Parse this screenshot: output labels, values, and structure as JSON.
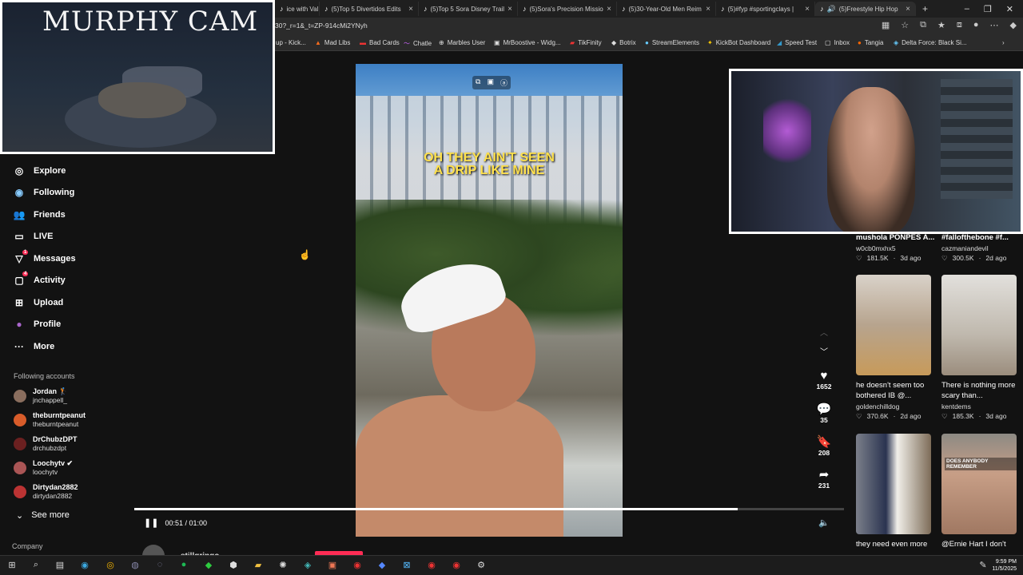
{
  "browser": {
    "tabs": [
      {
        "label": "ice with Val",
        "icon": "♪"
      },
      {
        "label": "(5)Top 5 Divertidos Edits",
        "icon": "♪"
      },
      {
        "label": "(5)Top 5 Sora Disney Trail",
        "icon": "♪"
      },
      {
        "label": "(5)Sora's Precision Missio",
        "icon": "♪"
      },
      {
        "label": "(5)30-Year-Old Men Reim",
        "icon": "♪"
      },
      {
        "label": "(5)#fyp #sportingclays |",
        "icon": "♪"
      },
      {
        "label": "(5)Freestyle Hip Hop",
        "icon": "♪"
      }
    ],
    "new_tab": "+",
    "url": "30?_r=1&_t=ZP-914cMi2YNyh",
    "bookmarks": [
      "up - Kick...",
      "Mad Libs",
      "Bad Cards",
      "Chatle",
      "Marbles User",
      "MrBoostive - Widg...",
      "TikFinity",
      "Botrix",
      "StreamElements",
      "KickBot Dashboard",
      "Speed Test",
      "Inbox",
      "Tangia",
      "Delta Force: Black Si..."
    ]
  },
  "murphy_cam": {
    "title": "MURPHY CAM"
  },
  "sidebar": {
    "items": [
      {
        "label": "Explore",
        "icon": "◎"
      },
      {
        "label": "Following",
        "icon": "◉"
      },
      {
        "label": "Friends",
        "icon": "👥"
      },
      {
        "label": "LIVE",
        "icon": "▭"
      },
      {
        "label": "Messages",
        "icon": "▽",
        "badge": "1"
      },
      {
        "label": "Activity",
        "icon": "▢",
        "badge": "4"
      },
      {
        "label": "Upload",
        "icon": "⊞"
      },
      {
        "label": "Profile",
        "icon": "●"
      },
      {
        "label": "More",
        "icon": "···"
      }
    ],
    "following_header": "Following accounts",
    "accounts": [
      {
        "name": "Jordan 🏌",
        "user": "jnchappell_"
      },
      {
        "name": "theburntpeanut",
        "user": "theburntpeanut"
      },
      {
        "name": "DrChubzDPT",
        "user": "drchubzdpt"
      },
      {
        "name": "Loochytv ✔",
        "user": "loochytv"
      },
      {
        "name": "Dirtydan2882",
        "user": "dirtydan2882"
      }
    ],
    "see_more": "See more",
    "company": "Company"
  },
  "video": {
    "caption_line1": "OH THEY AIN'T SEEN",
    "caption_line2": "A DRIP LIKE MINE",
    "time": "00:51 / 01:00",
    "progress": 0.85,
    "author": "stillgringo"
  },
  "actions": {
    "likes": "1652",
    "comments": "35",
    "saves": "208",
    "shares": "231"
  },
  "related": {
    "top": [
      {
        "title": "mushola PONPES A...",
        "author": "w0cb0mxhx5",
        "views": "181.5K",
        "age": "3d ago"
      },
      {
        "title": "#fallofthebone #f...",
        "author": "cazmaniandevil",
        "views": "300.5K",
        "age": "2d ago"
      }
    ],
    "cards": [
      {
        "title": "he doesn't seem too bothered IB @...",
        "author": "goldenchilldog",
        "views": "370.6K",
        "age": "2d ago"
      },
      {
        "title": "There is nothing more scary than...",
        "author": "kentdems",
        "views": "185.3K",
        "age": "3d ago"
      },
      {
        "title": "they need even more",
        "author": "",
        "views": "",
        "age": ""
      },
      {
        "title": "@Ernie Hart I don't",
        "author": "",
        "views": "",
        "age": ""
      }
    ],
    "thumb_overlay": "DOES ANYBODY REMEMBER"
  },
  "taskbar": {
    "time": "9:59 PM",
    "date": "11/5/2025"
  },
  "colors": {
    "accent": "#fe2c55",
    "caption": "#ffe14d",
    "background": "#121212"
  }
}
